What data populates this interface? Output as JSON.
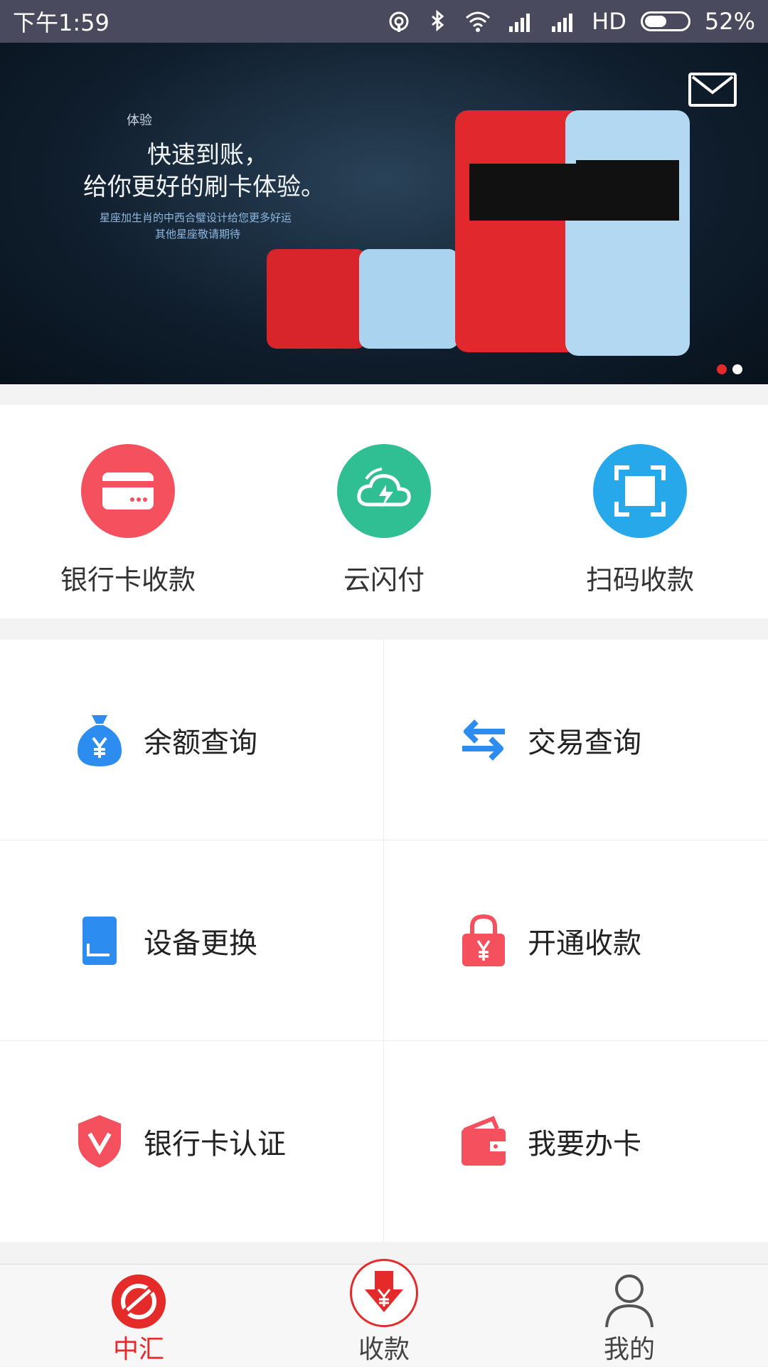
{
  "status_bar": {
    "time": "下午1:59",
    "network": "HD",
    "battery_percent": "52%",
    "battery_level": 0.52,
    "icons": [
      "hotspot-icon",
      "bluetooth-icon",
      "wifi-icon",
      "signal-icon",
      "signal-icon",
      "battery-icon"
    ]
  },
  "banner": {
    "small": "体验",
    "title_line1": "快速到账，",
    "title_line2": "给你更好的刷卡体验。",
    "subtitle_line1": "星座加生肖的中西合璧设计给您更多好运",
    "subtitle_line2": "其他星座敬请期待",
    "page_count": 2,
    "active_page": 1,
    "mail_icon": "mail-icon"
  },
  "quick_actions": [
    {
      "label": "银行卡收款",
      "icon": "card-icon",
      "color": "#f4505d"
    },
    {
      "label": "云闪付",
      "icon": "cloud-flash-icon",
      "color": "#2fbf93"
    },
    {
      "label": "扫码收款",
      "icon": "scan-icon",
      "color": "#27a8ea"
    }
  ],
  "menu": [
    {
      "label": "余额查询",
      "icon": "money-bag-icon",
      "color": "#2d8cf0"
    },
    {
      "label": "交易查询",
      "icon": "exchange-arrows-icon",
      "color": "#2d8cf0"
    },
    {
      "label": "设备更换",
      "icon": "device-icon",
      "color": "#2d8cf0"
    },
    {
      "label": "开通收款",
      "icon": "lock-yen-icon",
      "color": "#f4505d"
    },
    {
      "label": "银行卡认证",
      "icon": "shield-v-icon",
      "color": "#f4505d"
    },
    {
      "label": "我要办卡",
      "icon": "wallet-icon",
      "color": "#f4505d"
    }
  ],
  "tabs": [
    {
      "label": "中汇",
      "icon": "home-logo-icon",
      "active": true
    },
    {
      "label": "收款",
      "icon": "collect-icon",
      "active": false
    },
    {
      "label": "我的",
      "icon": "user-icon",
      "active": false
    }
  ],
  "colors": {
    "accent": "#e52a2a",
    "status_bar": "#4a4a5e"
  }
}
